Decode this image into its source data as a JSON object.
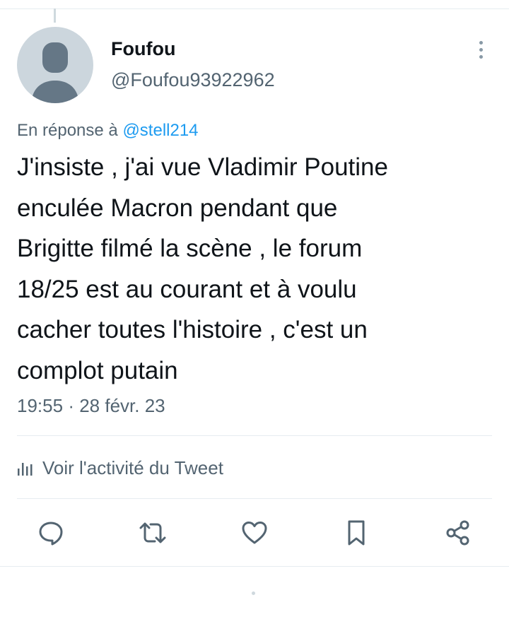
{
  "author": {
    "name": "Foufou",
    "handle": "@Foufou93922962"
  },
  "reply": {
    "prefix": "En réponse à ",
    "mention": "@stell214"
  },
  "tweet": {
    "text": "J'insiste , j'ai vue Vladimir Poutine\nenculée Macron pendant que\nBrigitte filmé la scène , le forum\n18/25 est au courant et à voulu\ncacher toutes l'histoire , c'est un\ncomplot putain",
    "time": "19:55",
    "separator": "·",
    "date": "28 févr. 23"
  },
  "analytics": {
    "label": "Voir l'activité du Tweet",
    "icon": "analytics-icon"
  },
  "actions": [
    {
      "name": "reply-button",
      "icon": "reply-icon"
    },
    {
      "name": "retweet-button",
      "icon": "retweet-icon"
    },
    {
      "name": "like-button",
      "icon": "heart-icon"
    },
    {
      "name": "bookmark-button",
      "icon": "bookmark-icon"
    },
    {
      "name": "share-button",
      "icon": "share-icon"
    }
  ],
  "colors": {
    "text": "#0f1419",
    "secondary": "#536471",
    "link": "#1d9bf0",
    "icon": "#536471",
    "divider": "#e6ecf0",
    "avatar_bg": "#ccd6dd",
    "avatar_fg": "#657786"
  }
}
